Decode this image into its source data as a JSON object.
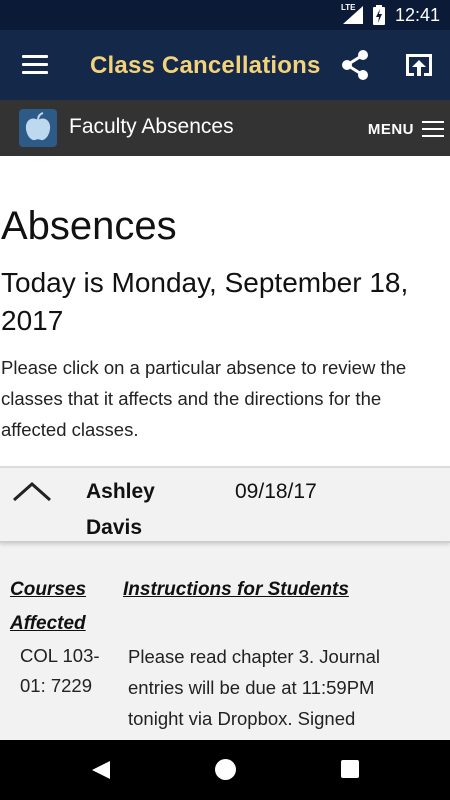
{
  "status_bar": {
    "network": "LTE",
    "time": "12:41",
    "icons": [
      "signal-icon",
      "battery-charging-icon"
    ]
  },
  "app_bar": {
    "title": "Class Cancellations",
    "title_color": "#f3d27a",
    "background": "#14284a",
    "icons": [
      "menu-icon",
      "share-icon",
      "open-in-browser-icon"
    ]
  },
  "sub_header": {
    "title": "Faculty Absences",
    "menu_label": "MENU",
    "background": "#333333"
  },
  "main": {
    "heading": "Absences",
    "today": "Today is Monday, September 18, 2017",
    "intro": "Please click on a particular absence to review the classes that it affects and the directions for the affected classes."
  },
  "absence": {
    "name": "Ashley Davis",
    "date": "09/18/17",
    "expanded": true,
    "columns": {
      "courses": "Courses Affected",
      "instructions": "Instructions for Students"
    },
    "courses": [
      {
        "code": "COL 103-01: 7229",
        "instructions": "Please read chapter 3. Journal entries will be due at 11:59PM tonight via Dropbox. Signed"
      }
    ]
  },
  "nav_bar": {
    "icons": [
      "back-icon",
      "home-icon",
      "recents-icon"
    ]
  }
}
